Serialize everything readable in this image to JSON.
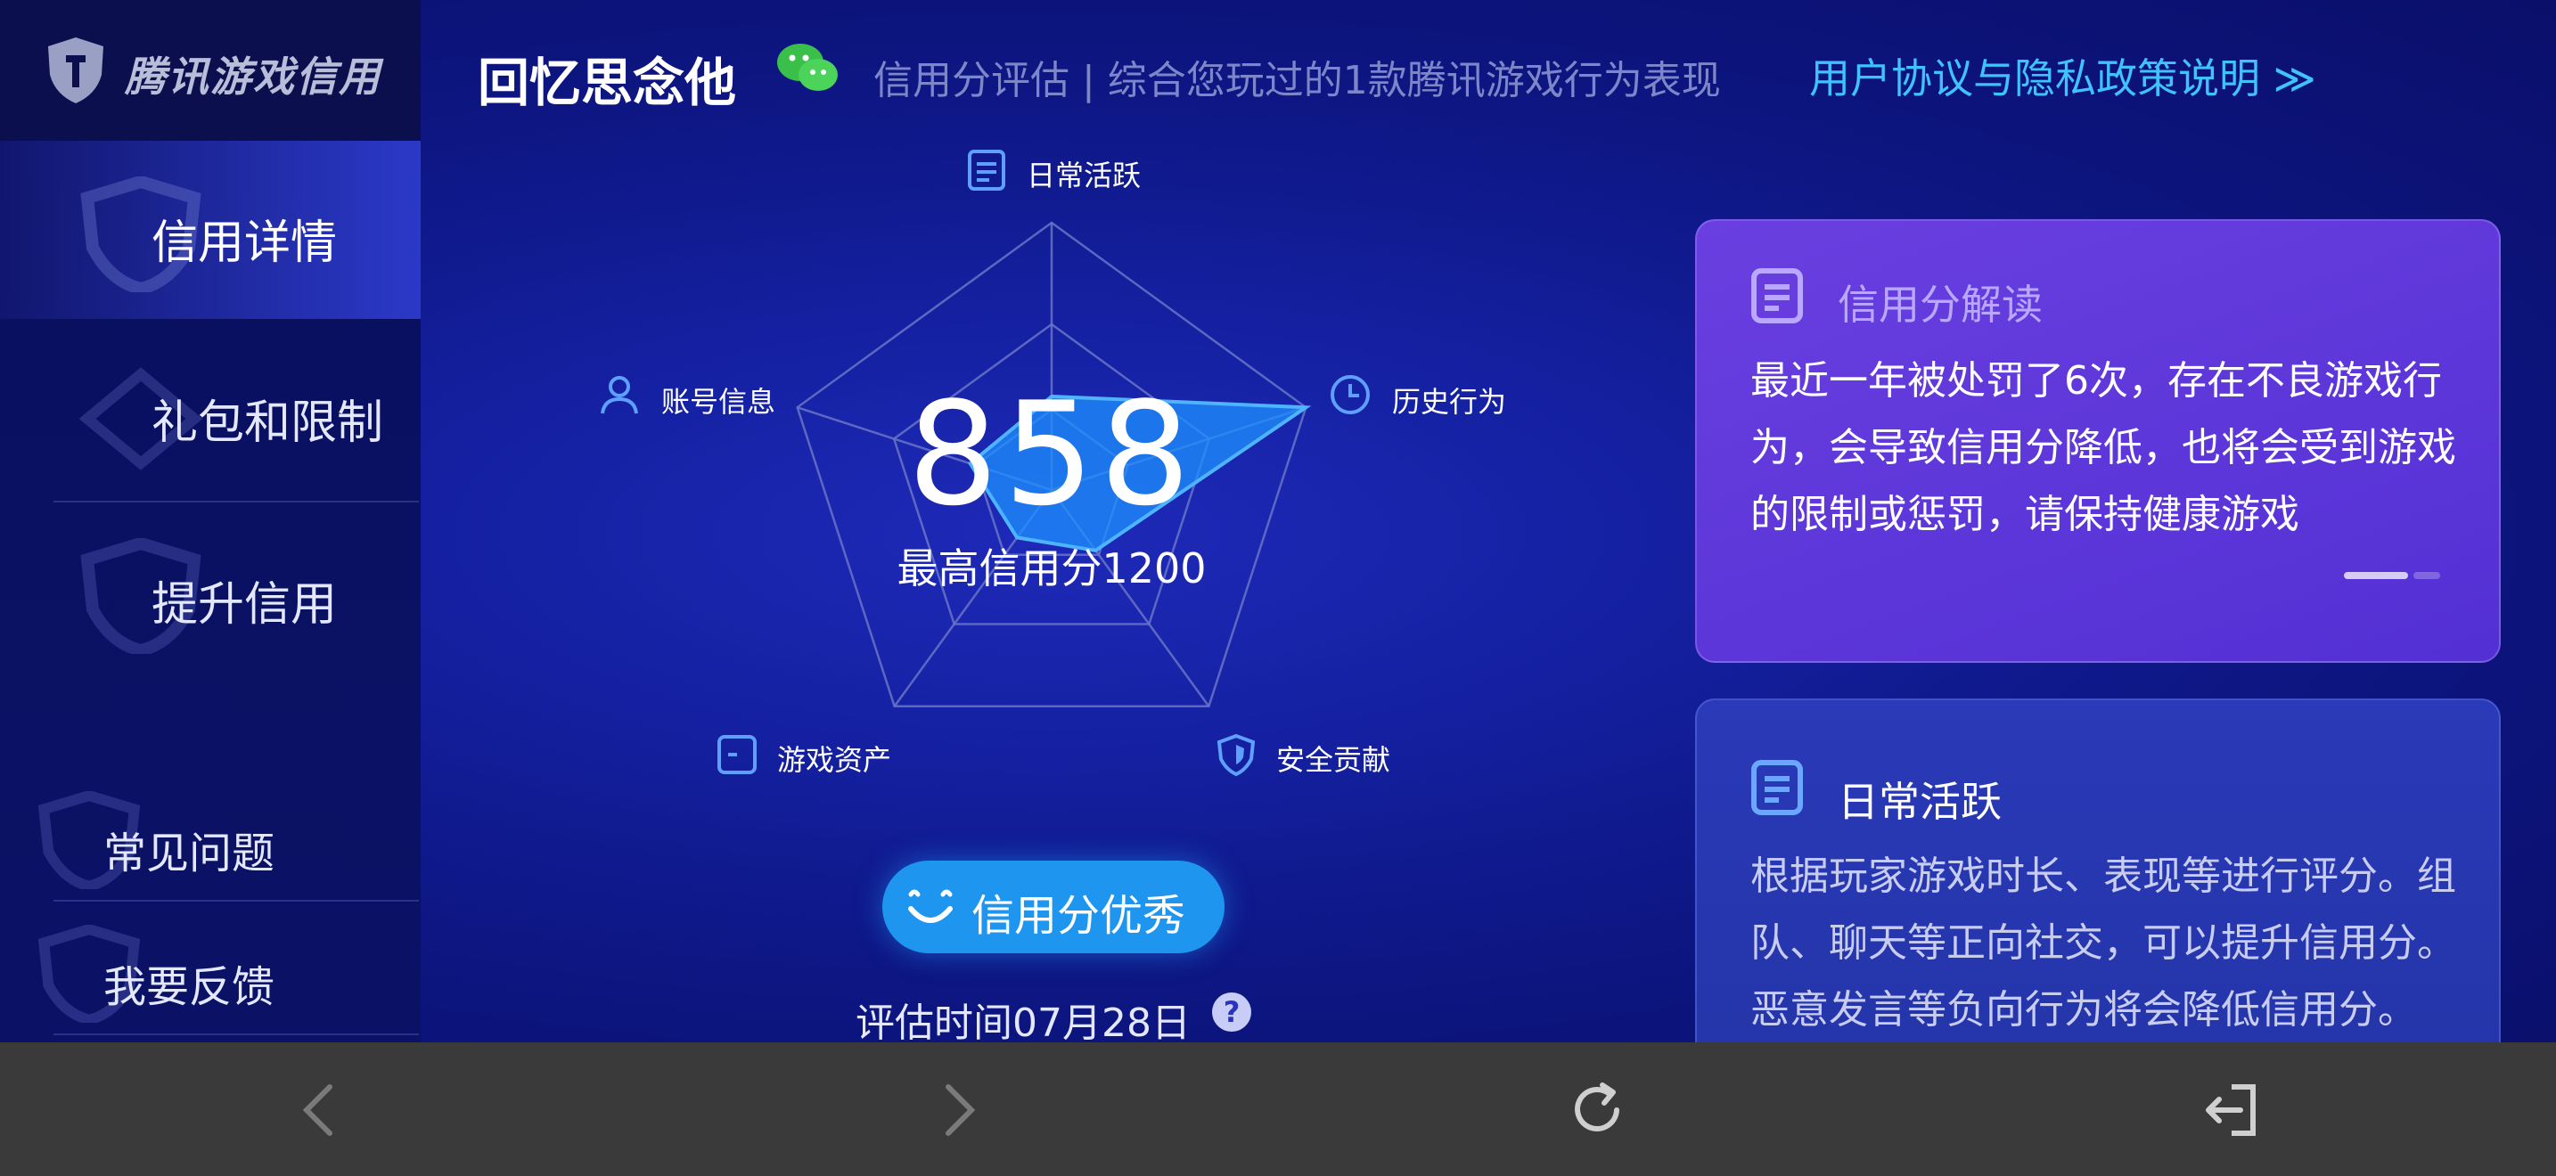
{
  "brand": {
    "name": "腾讯游戏信用"
  },
  "sidebar": {
    "items": [
      {
        "label": "信用详情",
        "active": true
      },
      {
        "label": "礼包和限制",
        "active": false
      },
      {
        "label": "提升信用",
        "active": false
      }
    ],
    "bottom_items": [
      {
        "label": "常见问题"
      },
      {
        "label": "我要反馈"
      }
    ]
  },
  "header": {
    "title": "回忆思念他",
    "subtitle": "信用分评估 | 综合您玩过的1款腾讯游戏行为表现",
    "policy_link": "用户协议与隐私政策说明 ≫"
  },
  "radar": {
    "score": "858",
    "max_label": "最高信用分1200",
    "axes": [
      {
        "label": "日常活跃",
        "icon": "document-icon",
        "value": 0.35
      },
      {
        "label": "历史行为",
        "icon": "clock-icon",
        "value": 1.0
      },
      {
        "label": "安全贡献",
        "icon": "shield-icon",
        "value": 0.28
      },
      {
        "label": "游戏资产",
        "icon": "wallet-icon",
        "value": 0.22
      },
      {
        "label": "账号信息",
        "icon": "user-icon",
        "value": 0.32
      }
    ],
    "colors": {
      "fill": "#1e90ff",
      "grid": "#6a74c8"
    }
  },
  "badge": {
    "label": "信用分优秀"
  },
  "eval_time": "评估时间07月28日",
  "help_glyph": "?",
  "cards": {
    "interpret": {
      "title": "信用分解读",
      "body": "最近一年被处罚了6次，存在不良游戏行为，会导致信用分降低，也将会受到游戏的限制或惩罚，请保持健康游戏"
    },
    "daily": {
      "title": "日常活跃",
      "body": "根据玩家游戏时长、表现等进行评分。组队、聊天等正向社交，可以提升信用分。恶意发言等负向行为将会降低信用分。"
    }
  },
  "colors": {
    "accent": "#3fc2ff",
    "bg": "#0d1682",
    "card_purple": "#5a35d8",
    "card_blue": "#2636aa"
  }
}
